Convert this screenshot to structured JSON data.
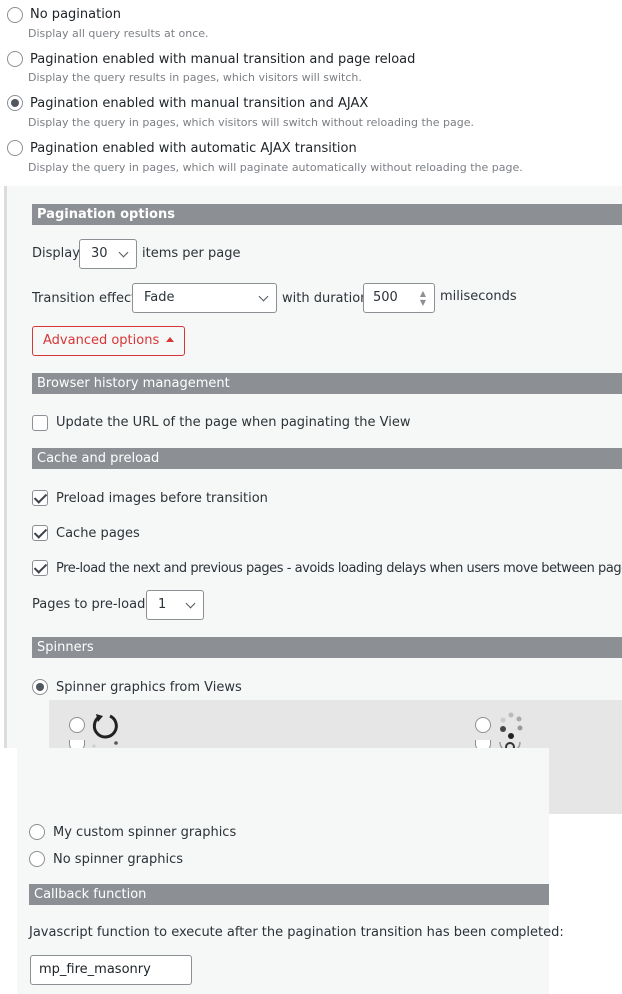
{
  "pagination_modes": [
    {
      "label": "No pagination",
      "description": "Display all query results at once.",
      "selected": false
    },
    {
      "label": "Pagination enabled with manual transition and page reload",
      "description": "Display the query results in pages, which visitors will switch.",
      "selected": false
    },
    {
      "label": "Pagination enabled with manual transition and AJAX",
      "description": "Display the query in pages, which visitors will switch without reloading the page.",
      "selected": true
    },
    {
      "label": "Pagination enabled with automatic AJAX transition",
      "description": "Display the query in pages, which will paginate automatically without reloading the page.",
      "selected": false
    }
  ],
  "pagination_options": {
    "title": "Pagination options",
    "display_label": "Display",
    "items_per_page_value": "30",
    "items_per_page_suffix": "items per page",
    "transition_label": "Transition effect:",
    "transition_value": "Fade",
    "duration_label": "with duration",
    "duration_value": "500",
    "duration_unit": "miliseconds",
    "advanced_button": "Advanced options"
  },
  "browser_history": {
    "title": "Browser history management",
    "update_url_label": "Update the URL of the page when paginating the View",
    "update_url_checked": false
  },
  "cache_preload": {
    "title": "Cache and preload",
    "preload_images_label": "Preload images before transition",
    "cache_pages_label": "Cache pages",
    "preload_pages_label": "Pre-load the next and previous pages - avoids loading delays when users move between pages",
    "pages_to_preload_label": "Pages to pre-load:",
    "pages_to_preload_value": "1"
  },
  "spinners": {
    "title": "Spinners",
    "views_label": "Spinner graphics from Views",
    "custom_label": "My custom spinner graphics",
    "none_label": "No spinner graphics",
    "icons": [
      "spinner-circle-arrow-icon",
      "spinner-dots-icon",
      "spinner-partial-dots-icon",
      "spinner-ring-icon",
      "spinner-bars-icon"
    ]
  },
  "callback": {
    "title": "Callback function",
    "description": "Javascript function to execute after the pagination transition has been completed:",
    "value": "mp_fire_masonry"
  },
  "colors": {
    "section_bar": "#8c8f94",
    "panel_bg": "#f6f7f7",
    "accent_red": "#d63638"
  }
}
